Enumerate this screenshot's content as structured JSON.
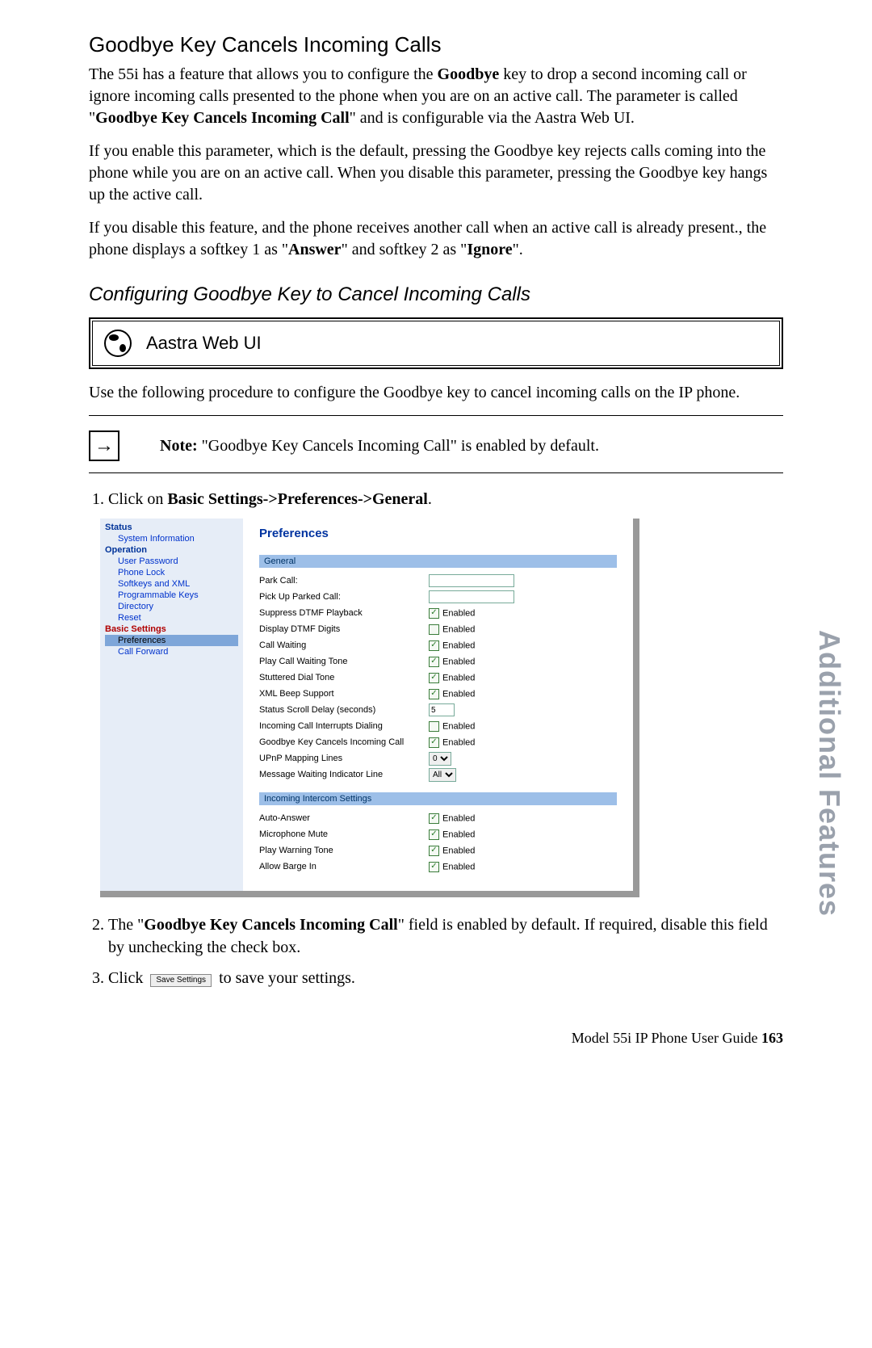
{
  "heading": "Goodbye Key Cancels Incoming Calls",
  "para1_a": "The 55i has a feature that allows you to configure the ",
  "para1_goodbye": "Goodbye",
  "para1_b": " key to drop a second incoming call or ignore incoming calls presented to the phone when you are on an active call. The parameter is called \"",
  "para1_param": "Goodbye Key Cancels Incoming Call",
  "para1_c": "\" and is configurable via the Aastra Web UI.",
  "para2": "If you enable this parameter, which is the default, pressing the Goodbye key rejects calls coming into the phone while you are on an active call. When you disable this parameter, pressing the Goodbye key hangs up the active call.",
  "para3_a": "If you disable this feature, and the phone receives another call when an active call is already present., the phone displays a softkey 1 as \"",
  "para3_answer": "Answer",
  "para3_b": "\" and softkey 2 as \"",
  "para3_ignore": "Ignore",
  "para3_c": "\".",
  "subheading": "Configuring Goodbye Key to Cancel Incoming Calls",
  "webui_label": "Aastra Web UI",
  "use_text": "Use the following procedure to configure the Goodbye key to cancel incoming calls on the IP phone.",
  "note_label": "Note:",
  "note_text": " \"Goodbye Key Cancels Incoming Call\" is enabled by default.",
  "step1_a": "Click on ",
  "step1_b": "Basic Settings->Preferences->General",
  "step1_c": ".",
  "step2_a": "The \"",
  "step2_b": "Goodbye Key Cancels Incoming Call",
  "step2_c": "\" field is enabled by default. If required, disable this field by unchecking the check box.",
  "step3_a": "Click ",
  "step3_btn": "Save Settings",
  "step3_b": " to save your settings.",
  "nav": {
    "status": "Status",
    "sysinfo": "System Information",
    "operation": "Operation",
    "userpw": "User Password",
    "phonelock": "Phone Lock",
    "softkeys": "Softkeys and XML",
    "progkeys": "Programmable Keys",
    "directory": "Directory",
    "reset": "Reset",
    "basic": "Basic Settings",
    "prefs": "Preferences",
    "callfwd": "Call Forward"
  },
  "prefs": {
    "title": "Preferences",
    "general": "General",
    "park": "Park Call:",
    "pickup": "Pick Up Parked Call:",
    "suppress_dtmf": "Suppress DTMF Playback",
    "display_dtmf": "Display DTMF Digits",
    "call_waiting": "Call Waiting",
    "cw_tone": "Play Call Waiting Tone",
    "stutter": "Stuttered Dial Tone",
    "xml_beep": "XML Beep Support",
    "scroll_delay": "Status Scroll Delay (seconds)",
    "scroll_val": "5",
    "interrupt": "Incoming Call Interrupts Dialing",
    "goodbye": "Goodbye Key Cancels Incoming Call",
    "upnp": "UPnP Mapping Lines",
    "upnp_val": "0",
    "mwi": "Message Waiting Indicator Line",
    "mwi_val": "All",
    "intercom_hdr": "Incoming Intercom Settings",
    "auto_answer": "Auto-Answer",
    "mic_mute": "Microphone Mute",
    "warn_tone": "Play Warning Tone",
    "barge": "Allow Barge In",
    "enabled": "Enabled"
  },
  "side_tab": "Additional Features",
  "footer_a": "Model 55i IP Phone User Guide   ",
  "footer_b": "163"
}
